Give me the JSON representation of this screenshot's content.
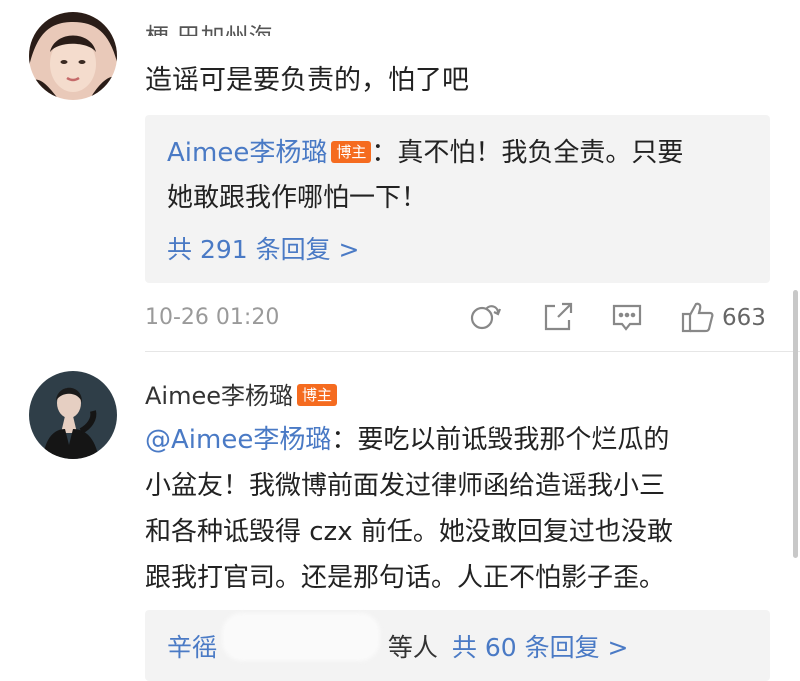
{
  "comment1": {
    "username_partial": "梗 巴加州海",
    "text": "造谣可是要负责的，怕了吧",
    "reply": {
      "author": "Aimee李杨璐",
      "badge": "博主",
      "line1": "：真不怕！我负全责。只要",
      "line2": "她敢跟我作哪怕一下！"
    },
    "view_replies": "共 291 条回复 >",
    "time": "10-26 01:20",
    "like_count": "663"
  },
  "comment2": {
    "username": "Aimee李杨璐",
    "badge": "博主",
    "mention": "@Aimee李杨璐",
    "line1_rest": "：要吃以前诋毁我那个烂瓜的",
    "line2": "小盆友！我微博前面发过律师函给造谣我小三",
    "line3": "和各种诋毁得 czx 前任。她没敢回复过也没敢",
    "line4": "跟我打官司。还是那句话。人正不怕影子歪。",
    "reply_prefix": "辛徭",
    "reply_suffix": "等人",
    "view_replies": "共 60 条回复 >"
  },
  "icons": {
    "repost": "repost-icon",
    "share": "share-icon",
    "comment": "comment-icon",
    "like": "thumbs-up-icon"
  },
  "colors": {
    "link_blue": "#4a7ac5",
    "badge_orange": "#f56b1f",
    "reply_bg": "#f3f3f3",
    "meta_gray": "#9a9a9a"
  }
}
